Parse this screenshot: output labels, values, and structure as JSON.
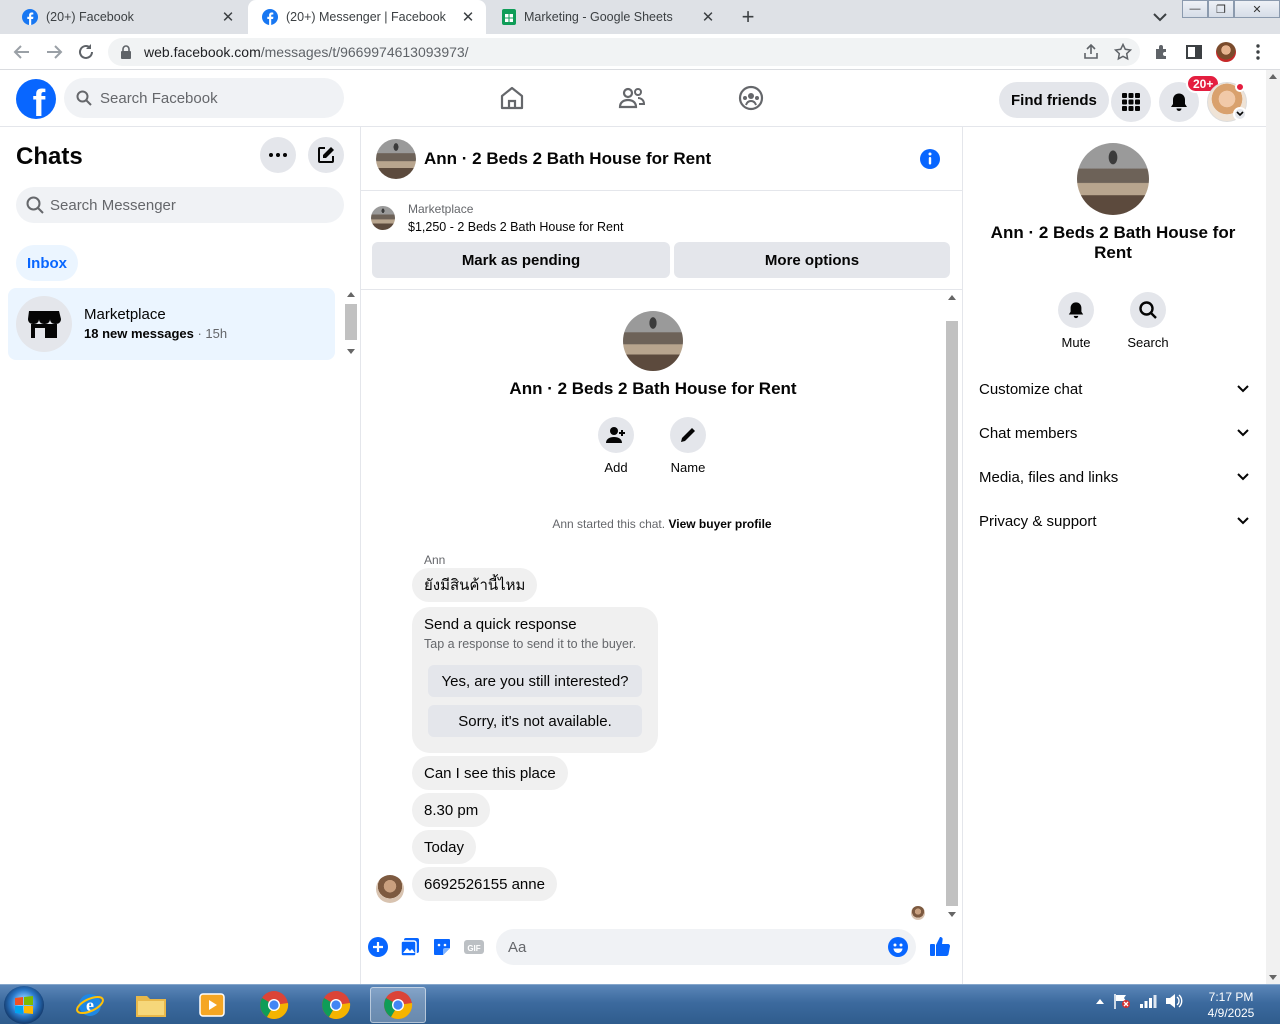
{
  "browser": {
    "tabs": [
      {
        "title": "(20+) Facebook",
        "icon": "facebook-favicon"
      },
      {
        "title": "(20+) Messenger | Facebook",
        "icon": "facebook-favicon",
        "active": true
      },
      {
        "title": "Marketing - Google Sheets",
        "icon": "sheets-favicon"
      }
    ],
    "url_host": "web.facebook.com",
    "url_path": "/messages/t/9669974613093973/"
  },
  "fb_header": {
    "search_placeholder": "Search Facebook",
    "find_friends": "Find friends",
    "notif_badge": "20+"
  },
  "chats": {
    "title": "Chats",
    "search_placeholder": "Search Messenger",
    "filter": "Inbox",
    "threads": [
      {
        "name": "Marketplace",
        "preview": "18 new messages",
        "time": "15h"
      }
    ]
  },
  "conversation": {
    "title": "Ann · 2 Beds 2 Bath House for Rent",
    "listing": {
      "label": "Marketplace",
      "text": "$1,250 - 2 Beds 2 Bath House for Rent",
      "btn_pending": "Mark as pending",
      "btn_more": "More options"
    },
    "intro_name": "Ann · 2 Beds 2 Bath House for Rent",
    "actions": {
      "add": "Add",
      "name": "Name"
    },
    "started_text": "Ann started this chat.",
    "view_profile": "View buyer profile",
    "sender": "Ann",
    "messages": [
      "ยังมีสินค้านี้ไหม",
      "Can I see this place",
      "8.30 pm",
      "Today",
      "6692526155 anne"
    ],
    "quick": {
      "title": "Send a quick response",
      "subtitle": "Tap a response to send it to the buyer.",
      "options": [
        "Yes, are you still interested?",
        "Sorry, it's not available."
      ]
    },
    "composer_placeholder": "Aa"
  },
  "info_panel": {
    "name": "Ann · 2 Beds 2 Bath House for Rent",
    "mute": "Mute",
    "search": "Search",
    "sections": [
      "Customize chat",
      "Chat members",
      "Media, files and links",
      "Privacy & support"
    ]
  },
  "taskbar": {
    "time": "7:17 PM",
    "date": "4/9/2025"
  },
  "colors": {
    "fb_blue": "#0866ff",
    "selected_bg": "#ebf5ff",
    "badge_red": "#e41e3f",
    "bubble_gray": "#f0f0f0"
  }
}
